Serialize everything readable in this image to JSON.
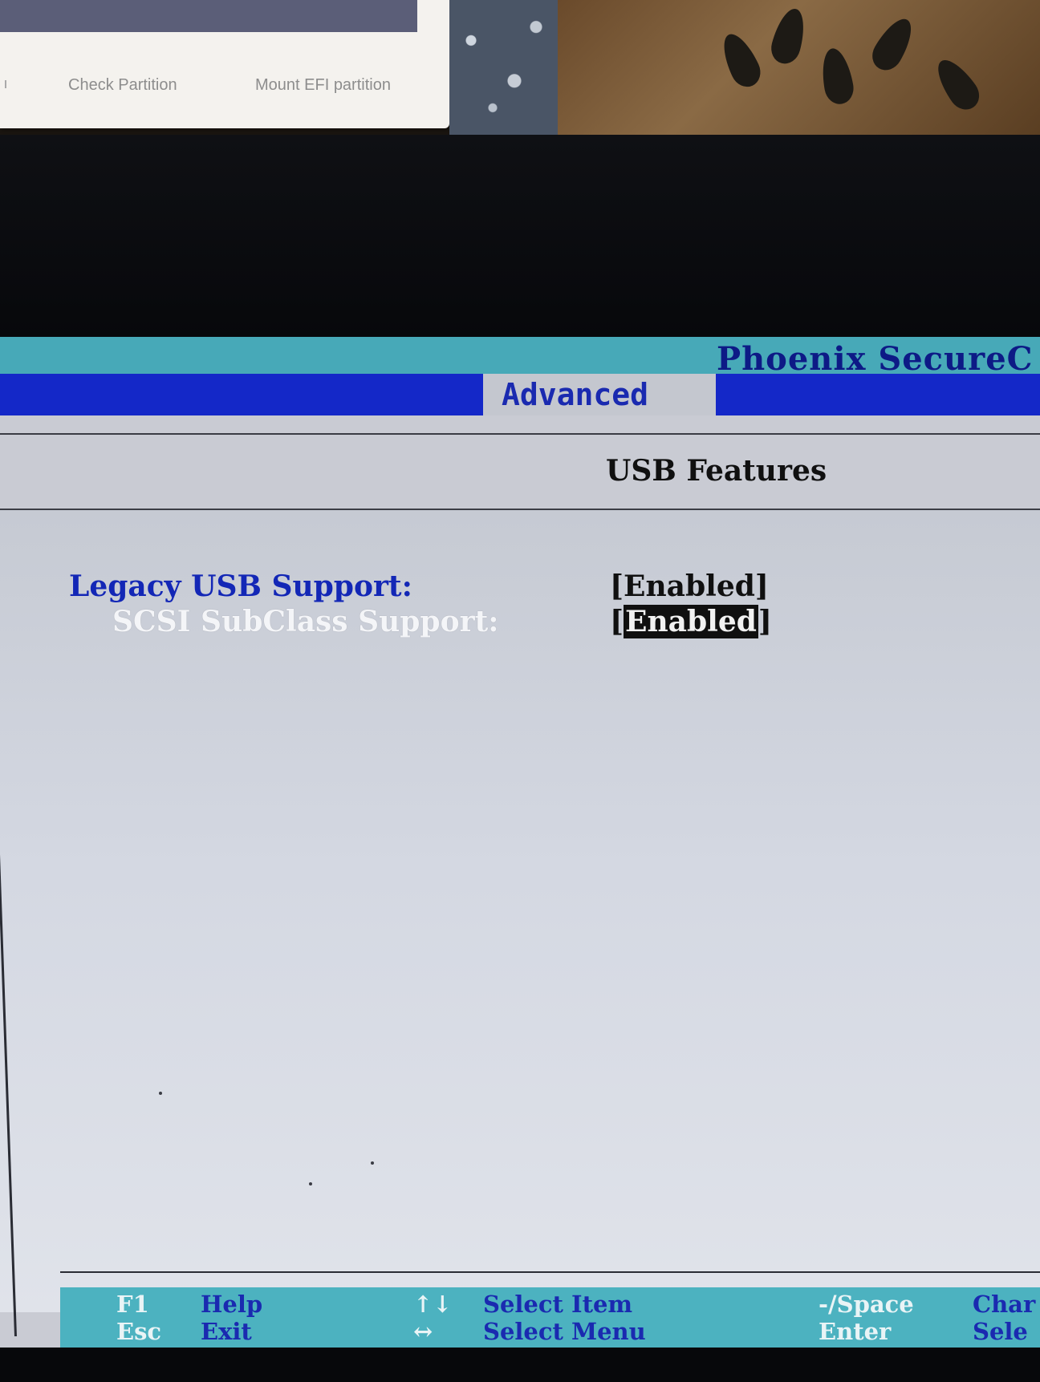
{
  "background_monitor": {
    "buttons": [
      {
        "label": "Check Partition"
      },
      {
        "label": "Mount EFI partition"
      }
    ]
  },
  "bios": {
    "title": "Phoenix SecureC",
    "active_tab": "Advanced",
    "section_title": "USB Features",
    "settings": [
      {
        "label": "Legacy USB Support:",
        "value": "[Enabled]"
      },
      {
        "label": "SCSI SubClass Support:",
        "value_prefix": "[",
        "value_highlight": "Enabled",
        "value_suffix": "]"
      }
    ],
    "footer": {
      "items": [
        {
          "key": "F1",
          "text": "Help"
        },
        {
          "key": "Esc",
          "text": "Exit"
        },
        {
          "key": "↑↓",
          "text": "Select Item"
        },
        {
          "key": "↔",
          "text": "Select Menu"
        },
        {
          "key": "-/Space",
          "text": "Char"
        },
        {
          "key": "Enter",
          "text": "Sele"
        }
      ]
    },
    "colors": {
      "title_bar": "#47a9b8",
      "menu_bar": "#1428c8",
      "background": "#c9cbd3",
      "label_blue": "#1327b6",
      "footer": "#4cb2c0"
    }
  }
}
